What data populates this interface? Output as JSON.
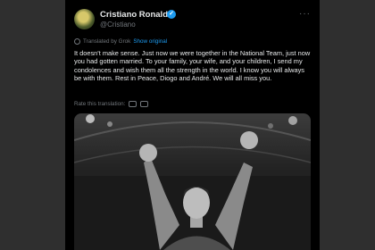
{
  "tweet": {
    "author_name": "Cristiano Ronaldo",
    "handle": "@Cristiano",
    "translated_prefix": "Translated by Grok",
    "show_original": "Show original",
    "text": "It doesn't make sense. Just now we were together in the National Team, just now you had gotten married. To your family, your wife, and your children, I send my condolences and wish them all the strength in the world. I know you will always be with them. Rest in Peace, Diogo and André. We will all miss you.",
    "rate_label": "Rate this translation:"
  },
  "icons": {
    "verified": "verified-badge-icon",
    "more": "more-icon",
    "globe": "globe-icon",
    "thumbs_up": "thumbs-up-icon",
    "thumbs_down": "thumbs-down-icon"
  },
  "colors": {
    "background": "#2f2f2f",
    "card": "#000000",
    "link": "#1d9bf0",
    "muted": "#71767b",
    "text": "#e7e9ea"
  }
}
